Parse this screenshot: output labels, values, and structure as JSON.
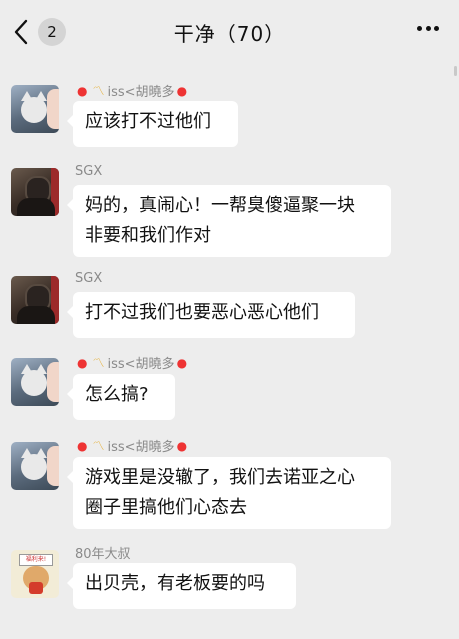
{
  "header": {
    "back_badge": "2",
    "title": "干净（70）"
  },
  "messages": [
    {
      "sender": "iss<胡曉多",
      "avatar": "cat-girl-avatar",
      "lines": [
        "应该打不过他们"
      ]
    },
    {
      "sender": "SGX",
      "avatar": "dark-portrait-avatar",
      "lines": [
        "妈的，真闹心！一帮臭傻逼聚一块",
        "非要和我们作对"
      ]
    },
    {
      "sender": "SGX",
      "avatar": "dark-portrait-avatar",
      "lines": [
        "打不过我们也要恶心恶心他们"
      ]
    },
    {
      "sender": "iss<胡曉多",
      "avatar": "cat-girl-avatar",
      "lines": [
        "怎么搞?"
      ]
    },
    {
      "sender": "iss<胡曉多",
      "avatar": "cat-girl-avatar",
      "lines": [
        "游戏里是没辙了，我们去诺亚之心",
        "圈子里搞他们心态去"
      ]
    },
    {
      "sender": "80年大叔",
      "avatar": "sticker-bear-avatar",
      "lines": [
        "出贝壳，有老板要的吗"
      ]
    }
  ],
  "sticker_sign": "福利来!",
  "colors": {
    "background": "#ededed",
    "bubble": "#ffffff",
    "sender_name": "#8a8a8a",
    "balloon": "#e33333"
  }
}
